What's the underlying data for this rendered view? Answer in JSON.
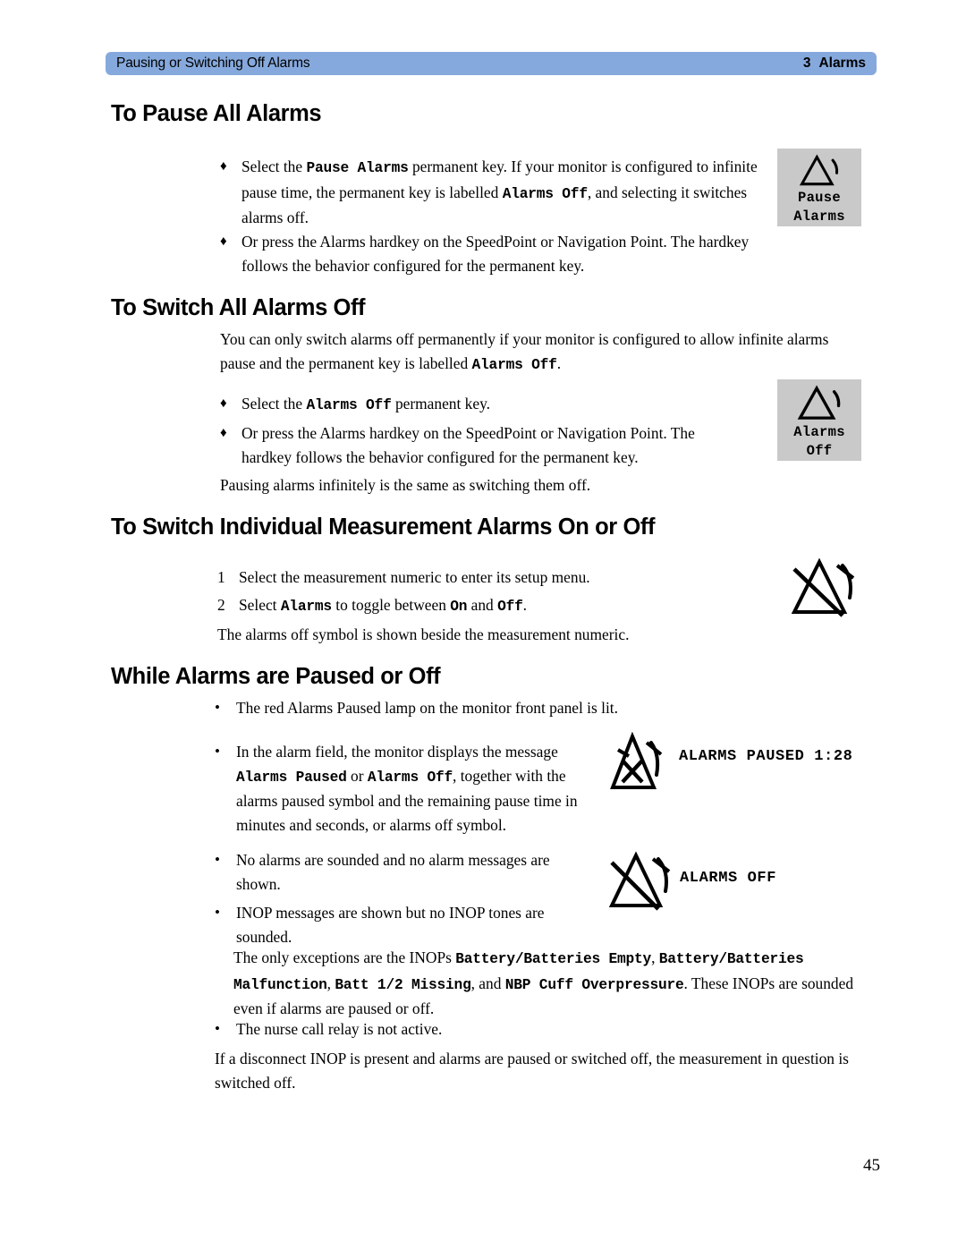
{
  "header": {
    "running_head": "Pausing or Switching Off Alarms",
    "chapter_number": "3",
    "chapter_name": "Alarms",
    "bar_color": "#86a9dd"
  },
  "page_number": "45",
  "sections": [
    {
      "id": "pause-all-alarms",
      "title": "To Pause All Alarms",
      "bullets": [
        {
          "mark": "♦",
          "parts": [
            {
              "text": "Select the ",
              "style": "normal"
            },
            {
              "text": "Pause Alarms",
              "style": "mono"
            },
            {
              "text": " permanent key. If your monitor is configured to infinite pause time, the permanent key is labelled ",
              "style": "normal"
            },
            {
              "text": "Alarms Off",
              "style": "mono"
            },
            {
              "text": ", and selecting it switches alarms off.",
              "style": "normal"
            }
          ]
        },
        {
          "mark": "♦",
          "parts": [
            {
              "text": "Or press the Alarms hardkey on the SpeedPoint or Navigation Point. The hardkey follows the behavior configured for the permanent key.",
              "style": "normal"
            }
          ]
        }
      ]
    },
    {
      "id": "switch-all-alarms-off",
      "title": "To Switch All Alarms Off",
      "intro": [
        {
          "text": "You can only switch alarms off permanently if your monitor is configured to allow infinite alarms pause and the permanent key is labelled ",
          "style": "normal"
        },
        {
          "text": "Alarms Off",
          "style": "mono"
        },
        {
          "text": ".",
          "style": "normal"
        }
      ],
      "bullets": [
        {
          "mark": "♦",
          "parts": [
            {
              "text": "Select the ",
              "style": "normal"
            },
            {
              "text": "Alarms Off",
              "style": "mono"
            },
            {
              "text": " permanent key.",
              "style": "normal"
            }
          ]
        },
        {
          "mark": "♦",
          "parts": [
            {
              "text": "Or press the Alarms hardkey on the SpeedPoint or Navigation Point. The hardkey follows the behavior configured for the permanent key.",
              "style": "normal"
            }
          ]
        }
      ],
      "closing": [
        {
          "text": "Pausing alarms infinitely is the same as switching them off.",
          "style": "normal"
        }
      ]
    },
    {
      "id": "switch-individual-measurement-alarms",
      "title": "To Switch Individual Measurement Alarms On or Off",
      "steps": [
        {
          "mark": "1",
          "parts": [
            {
              "text": "Select the measurement numeric to enter its setup menu.",
              "style": "normal"
            }
          ]
        },
        {
          "mark": "2",
          "parts": [
            {
              "text": "Select ",
              "style": "normal"
            },
            {
              "text": "Alarms",
              "style": "mono"
            },
            {
              "text": " to toggle between ",
              "style": "normal"
            },
            {
              "text": "On",
              "style": "mono"
            },
            {
              "text": " and ",
              "style": "normal"
            },
            {
              "text": "Off",
              "style": "mono"
            },
            {
              "text": ".",
              "style": "normal"
            }
          ]
        }
      ],
      "closing": [
        {
          "text": "The alarms off symbol is shown beside the measurement numeric.",
          "style": "normal"
        }
      ]
    },
    {
      "id": "while-alarms-paused-or-off",
      "title": "While Alarms are Paused or Off",
      "bullets": [
        {
          "mark": "•",
          "parts": [
            {
              "text": "The red Alarms Paused lamp on the monitor front panel is lit.",
              "style": "normal"
            }
          ]
        },
        {
          "mark": "•",
          "parts": [
            {
              "text": "In the alarm field, the monitor displays the message ",
              "style": "normal"
            },
            {
              "text": "Alarms Paused",
              "style": "mono"
            },
            {
              "text": " or ",
              "style": "normal"
            },
            {
              "text": "Alarms Off",
              "style": "mono"
            },
            {
              "text": ", together with the alarms paused symbol and the remaining pause time in minutes and seconds, or alarms off symbol.",
              "style": "normal"
            }
          ]
        },
        {
          "mark": "•",
          "parts": [
            {
              "text": "No alarms are sounded and no alarm messages are shown.",
              "style": "normal"
            }
          ]
        },
        {
          "mark": "•",
          "parts": [
            {
              "text": "INOP messages are shown but no INOP tones are sounded.",
              "style": "normal"
            }
          ]
        }
      ],
      "inop_note": [
        {
          "text": "The only exceptions are the INOPs ",
          "style": "normal"
        },
        {
          "text": "Battery/Batteries Empty",
          "style": "mono"
        },
        {
          "text": ", ",
          "style": "normal"
        },
        {
          "text": "Battery/",
          "style": "mono"
        },
        {
          "text": "Batteries Malfunction",
          "style": "mono"
        },
        {
          "text": ", ",
          "style": "normal"
        },
        {
          "text": "Batt 1/2 Missing",
          "style": "mono"
        },
        {
          "text": ", and ",
          "style": "normal"
        },
        {
          "text": "NBP Cuff Overpressure",
          "style": "mono"
        },
        {
          "text": ". These INOPs are sounded even if alarms are paused or off.",
          "style": "normal"
        }
      ],
      "nurse_call": {
        "mark": "•",
        "parts": [
          {
            "text": "The nurse call relay is not active.",
            "style": "normal"
          }
        ]
      },
      "closing": [
        {
          "text": "If a disconnect INOP is present and alarms are paused or switched off, the measurement in question is switched off.",
          "style": "normal"
        }
      ]
    }
  ],
  "keys": [
    {
      "id": "pause-alarms-key",
      "icon": "alarm-bell-icon",
      "lines": [
        "Pause",
        "Alarms"
      ],
      "background": "#c9c9c9"
    },
    {
      "id": "alarms-off-key",
      "icon": "alarm-bell-icon",
      "lines": [
        "Alarms",
        "Off"
      ],
      "background": "#c9c9c9"
    }
  ],
  "symbols": [
    {
      "id": "alarms-off-symbol-large",
      "icon": "alarms-off-crossed-bell-icon",
      "caption": ""
    },
    {
      "id": "alarms-paused-symbol",
      "icon": "alarms-paused-crossed-bell-icon",
      "caption": "ALARMS PAUSED 1:28"
    },
    {
      "id": "alarms-off-symbol",
      "icon": "alarms-off-crossed-bell-icon",
      "caption": "ALARMS OFF"
    }
  ]
}
